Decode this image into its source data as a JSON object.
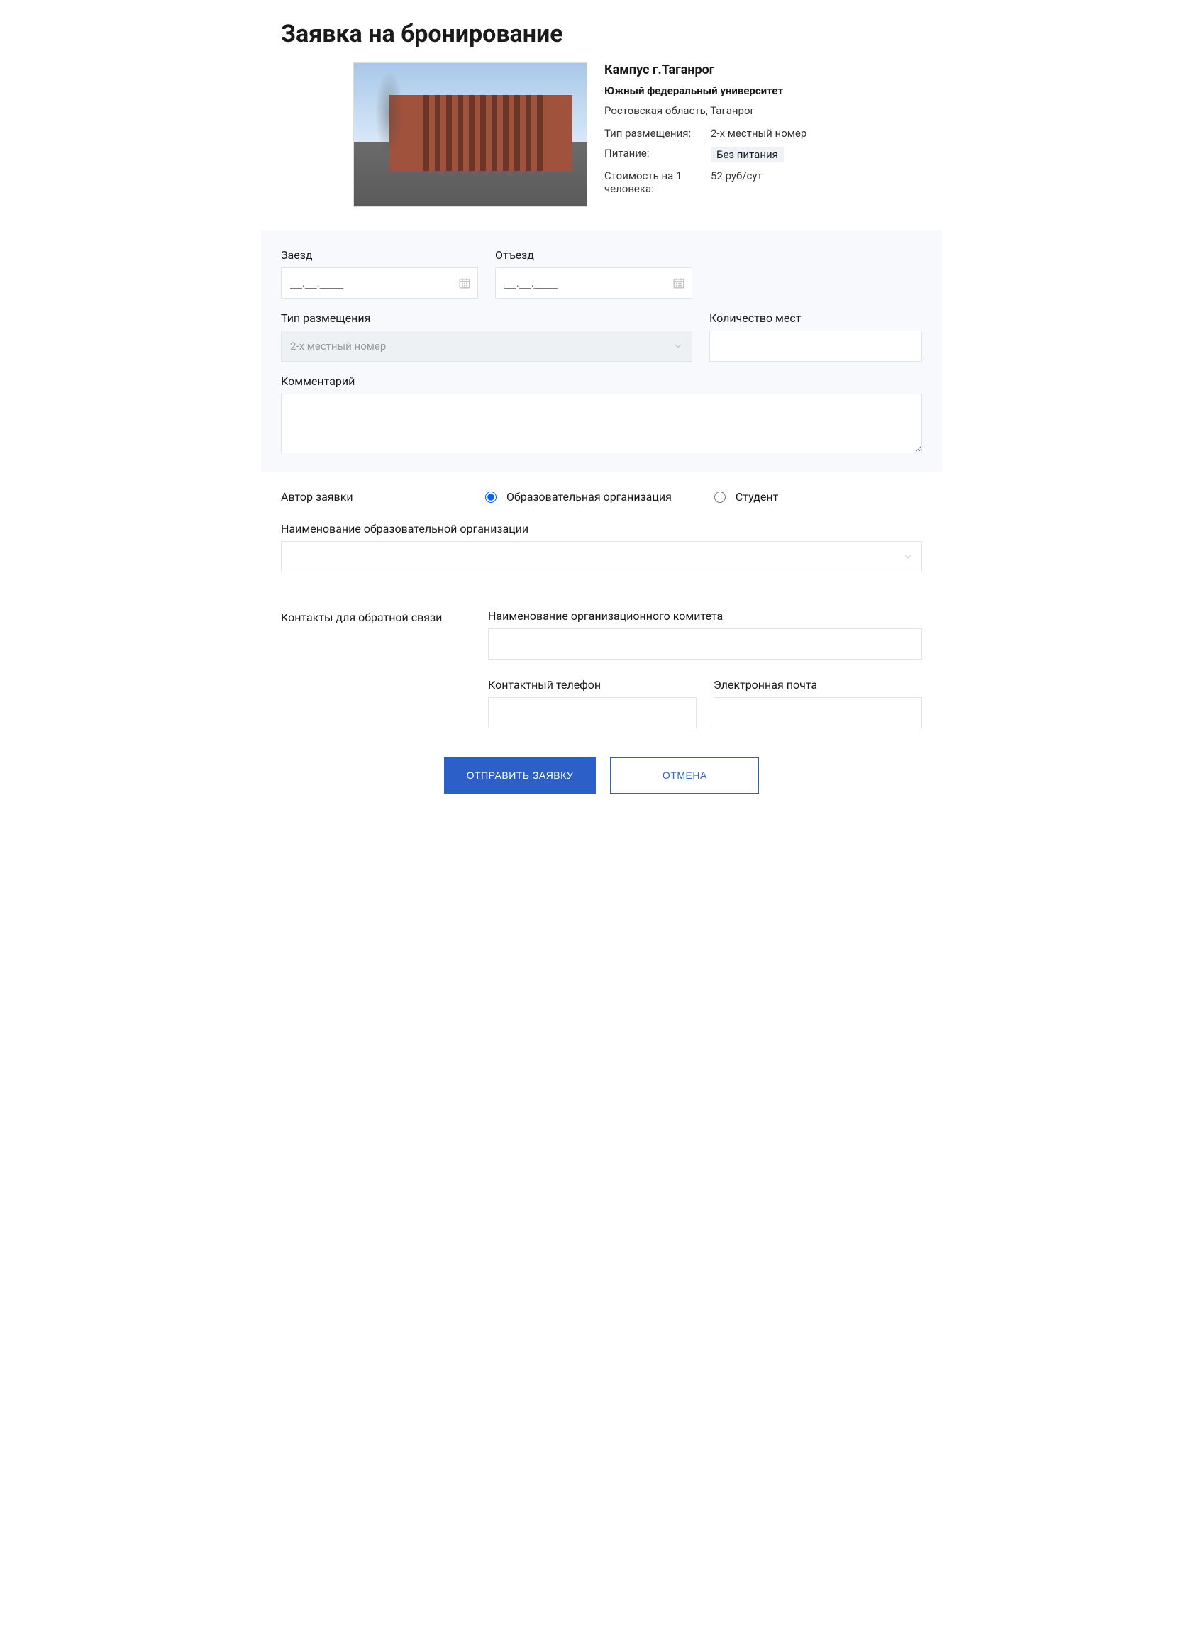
{
  "page_title": "Заявка на бронирование",
  "campus": {
    "title": "Кампус г.Таганрог",
    "university": "Южный федеральный университет",
    "region": "Ростовская область, Таганрог",
    "type_label": "Тип размещения:",
    "type_value": "2-х местный номер",
    "meals_label": "Питание:",
    "meals_value": "Без питания",
    "cost_label": "Стоимость на 1 человека:",
    "cost_value": "52 руб/сут"
  },
  "form": {
    "checkin_label": "Заезд",
    "checkin_placeholder": "__.__.____",
    "checkout_label": "Отъезд",
    "checkout_placeholder": "__.__.____",
    "room_type_label": "Тип размещения",
    "room_type_value": "2-х местный номер",
    "places_label": "Количество мест",
    "comment_label": "Комментарий"
  },
  "author": {
    "section_label": "Автор заявки",
    "option_org": "Образовательная организация",
    "option_student": "Студент",
    "org_name_label": "Наименование образовательной организации"
  },
  "contacts": {
    "section_label": "Контакты для обратной связи",
    "committee_label": "Наименование организационного комитета",
    "phone_label": "Контактный телефон",
    "email_label": "Электронная почта"
  },
  "buttons": {
    "submit": "ОТПРАВИТЬ ЗАЯВКУ",
    "cancel": "ОТМЕНА"
  }
}
